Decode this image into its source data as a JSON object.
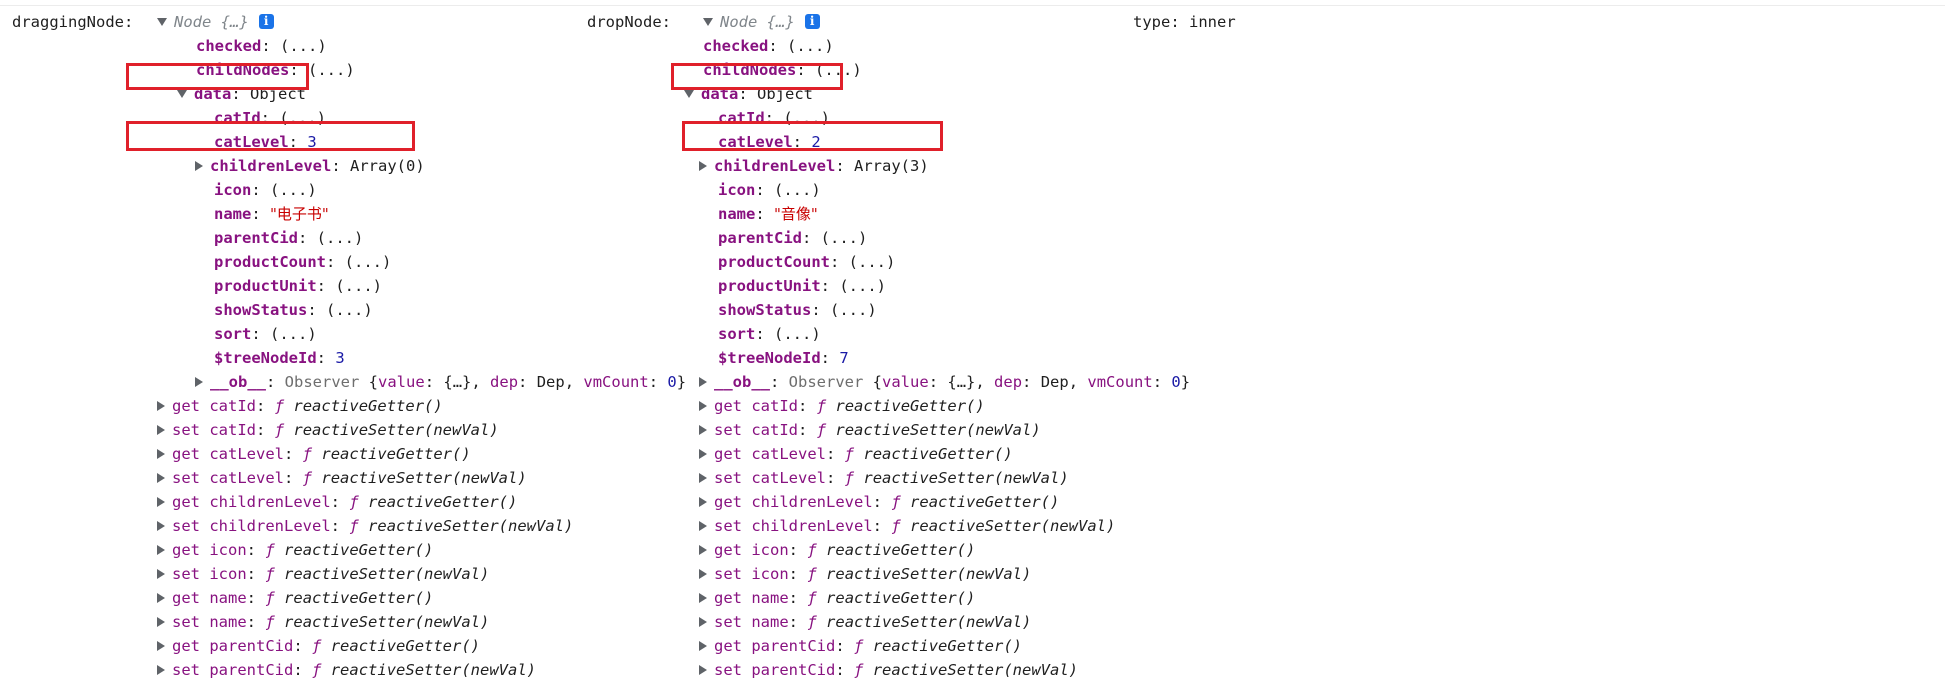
{
  "left": {
    "label": "draggingNode:",
    "node_type": "Node {…}",
    "info_glyph": "i",
    "checked_key": "checked",
    "checked_val": "(...)",
    "childNodes_key": "childNodes",
    "childNodes_val": "(...)",
    "data_key": "data",
    "data_val": "Object",
    "catId_key": "catId",
    "catId_val": "(...)",
    "catLevel_key": "catLevel",
    "catLevel_val": "3",
    "childrenLevel_key": "childrenLevel",
    "childrenLevel_val": "Array(0)",
    "icon_key": "icon",
    "icon_val": "(...)",
    "name_key": "name",
    "name_val": "\"电子书\"",
    "parentCid_key": "parentCid",
    "parentCid_val": "(...)",
    "productCount_key": "productCount",
    "productCount_val": "(...)",
    "productUnit_key": "productUnit",
    "productUnit_val": "(...)",
    "showStatus_key": "showStatus",
    "showStatus_val": "(...)",
    "sort_key": "sort",
    "sort_val": "(...)",
    "treeNodeId_key": "$treeNodeId",
    "treeNodeId_val": "3",
    "ob_key": "__ob__",
    "ob_class": "Observer",
    "ob_open": "{",
    "ob_value_key": "value",
    "ob_value_val": "{…}",
    "ob_dep_key": "dep",
    "ob_dep_val": "Dep",
    "ob_vm_key": "vmCount",
    "ob_vm_val": "0",
    "ob_close": "}",
    "accessors": [
      {
        "prefix": "get",
        "key": "catId",
        "fn": "reactiveGetter()"
      },
      {
        "prefix": "set",
        "key": "catId",
        "fn": "reactiveSetter(newVal)"
      },
      {
        "prefix": "get",
        "key": "catLevel",
        "fn": "reactiveGetter()"
      },
      {
        "prefix": "set",
        "key": "catLevel",
        "fn": "reactiveSetter(newVal)"
      },
      {
        "prefix": "get",
        "key": "childrenLevel",
        "fn": "reactiveGetter()"
      },
      {
        "prefix": "set",
        "key": "childrenLevel",
        "fn": "reactiveSetter(newVal)"
      },
      {
        "prefix": "get",
        "key": "icon",
        "fn": "reactiveGetter()"
      },
      {
        "prefix": "set",
        "key": "icon",
        "fn": "reactiveSetter(newVal)"
      },
      {
        "prefix": "get",
        "key": "name",
        "fn": "reactiveGetter()"
      },
      {
        "prefix": "set",
        "key": "name",
        "fn": "reactiveSetter(newVal)"
      },
      {
        "prefix": "get",
        "key": "parentCid",
        "fn": "reactiveGetter()"
      },
      {
        "prefix": "set",
        "key": "parentCid",
        "fn": "reactiveSetter(newVal)"
      }
    ]
  },
  "right": {
    "label": "dropNode:",
    "node_type": "Node {…}",
    "info_glyph": "i",
    "checked_key": "checked",
    "checked_val": "(...)",
    "childNodes_key": "childNodes",
    "childNodes_val": "(...)",
    "data_key": "data",
    "data_val": "Object",
    "catId_key": "catId",
    "catId_val": "(...)",
    "catLevel_key": "catLevel",
    "catLevel_val": "2",
    "childrenLevel_key": "childrenLevel",
    "childrenLevel_val": "Array(3)",
    "icon_key": "icon",
    "icon_val": "(...)",
    "name_key": "name",
    "name_val": "\"音像\"",
    "parentCid_key": "parentCid",
    "parentCid_val": "(...)",
    "productCount_key": "productCount",
    "productCount_val": "(...)",
    "productUnit_key": "productUnit",
    "productUnit_val": "(...)",
    "showStatus_key": "showStatus",
    "showStatus_val": "(...)",
    "sort_key": "sort",
    "sort_val": "(...)",
    "treeNodeId_key": "$treeNodeId",
    "treeNodeId_val": "7",
    "ob_key": "__ob__",
    "ob_class": "Observer",
    "ob_open": "{",
    "ob_value_key": "value",
    "ob_value_val": "{…}",
    "ob_dep_key": "dep",
    "ob_dep_val": "Dep",
    "ob_vm_key": "vmCount",
    "ob_vm_val": "0",
    "ob_close": "}",
    "accessors": [
      {
        "prefix": "get",
        "key": "catId",
        "fn": "reactiveGetter()"
      },
      {
        "prefix": "set",
        "key": "catId",
        "fn": "reactiveSetter(newVal)"
      },
      {
        "prefix": "get",
        "key": "catLevel",
        "fn": "reactiveGetter()"
      },
      {
        "prefix": "set",
        "key": "catLevel",
        "fn": "reactiveSetter(newVal)"
      },
      {
        "prefix": "get",
        "key": "childrenLevel",
        "fn": "reactiveGetter()"
      },
      {
        "prefix": "set",
        "key": "childrenLevel",
        "fn": "reactiveSetter(newVal)"
      },
      {
        "prefix": "get",
        "key": "icon",
        "fn": "reactiveGetter()"
      },
      {
        "prefix": "set",
        "key": "icon",
        "fn": "reactiveSetter(newVal)"
      },
      {
        "prefix": "get",
        "key": "name",
        "fn": "reactiveGetter()"
      },
      {
        "prefix": "set",
        "key": "name",
        "fn": "reactiveSetter(newVal)"
      },
      {
        "prefix": "get",
        "key": "parentCid",
        "fn": "reactiveGetter()"
      },
      {
        "prefix": "set",
        "key": "parentCid",
        "fn": "reactiveSetter(newVal)"
      }
    ]
  },
  "type_label": "type: inner",
  "colors": {
    "highlight": "#e0202a",
    "key": "#881280",
    "number": "#1a1aa6",
    "string": "#c80000",
    "info": "#1a73e8"
  }
}
